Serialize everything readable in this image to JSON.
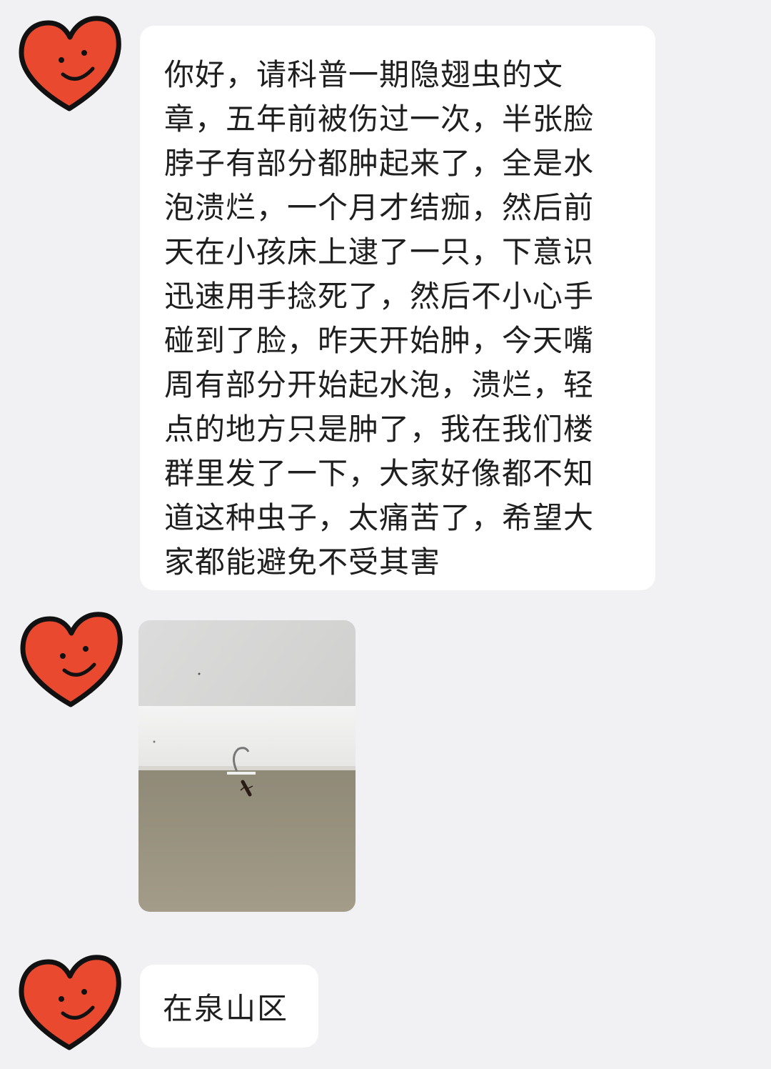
{
  "messages": [
    {
      "type": "text",
      "lines": [
        "你好，请科普一期隐翅虫的文",
        "章，五年前被伤过一次，半张脸",
        "脖子有部分都肿起来了，全是水",
        "泡溃烂，一个月才结痂，然后前",
        "天在小孩床上逮了一只，下意识",
        "迅速用手捻死了，然后不小心手",
        "碰到了脸，昨天开始肿，今天嘴",
        "周有部分开始起水泡，溃烂，轻",
        "点的地方只是肿了，我在我们楼",
        "群里发了一下，大家好像都不知",
        "道这种虫子，太痛苦了，希望大",
        "家都能避免不受其害"
      ]
    },
    {
      "type": "image",
      "image_icon": "photo-of-insect-on-wall"
    },
    {
      "type": "text",
      "text": "在泉山区"
    }
  ],
  "avatar": {
    "icon": "heart-smiley-icon",
    "fill_color": "#e8492f",
    "outline_color": "#111111"
  },
  "colors": {
    "background": "#f1f1f3",
    "bubble": "#ffffff",
    "text": "#1f1f1f"
  }
}
